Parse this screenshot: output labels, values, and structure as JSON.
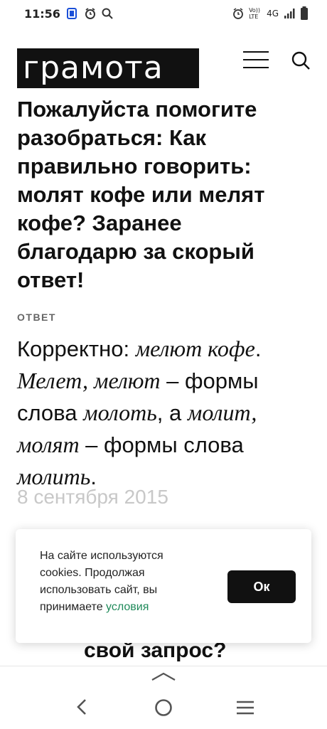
{
  "status_bar": {
    "time": "11:56",
    "left_icons": [
      "battery-saver-icon",
      "alarm-icon",
      "search-icon"
    ],
    "right_icons": [
      "alarm-clock-icon",
      "volte-icon",
      "signal-icon",
      "battery-icon"
    ],
    "volte": "Vo)) LTE",
    "network": "4G"
  },
  "header": {
    "logo": "грамота",
    "menu_icon": "hamburger-menu-icon",
    "search_icon": "search-icon"
  },
  "question": {
    "text": "Пожалуйста помогите разобраться: Как правильно говорить: молят кофе или мелят кофе? Заранее благодарю за скорый ответ!"
  },
  "answer": {
    "label": "ОТВЕТ",
    "p1": "Корректно: ",
    "i1": "мелют кофе",
    "p2": ". ",
    "i2": "Мелет, мелют",
    "p3": " – формы слова ",
    "i3": "молоть",
    "p4": ", а ",
    "i4": "молит, молят",
    "p5": " – формы слова ",
    "i5": "молить",
    "p6": "."
  },
  "date": "8 сентября 2015",
  "cookie_banner": {
    "text": "На сайте используются cookies. Продолжая использовать сайт, вы принимаете ",
    "link": "условия",
    "button": "Ок",
    "link_color": "#1f8a5a"
  },
  "partial_heading": "свой запрос?",
  "nav_bar": {
    "icons": [
      "chevron-up-icon",
      "back-icon",
      "home-icon",
      "recents-icon"
    ]
  }
}
